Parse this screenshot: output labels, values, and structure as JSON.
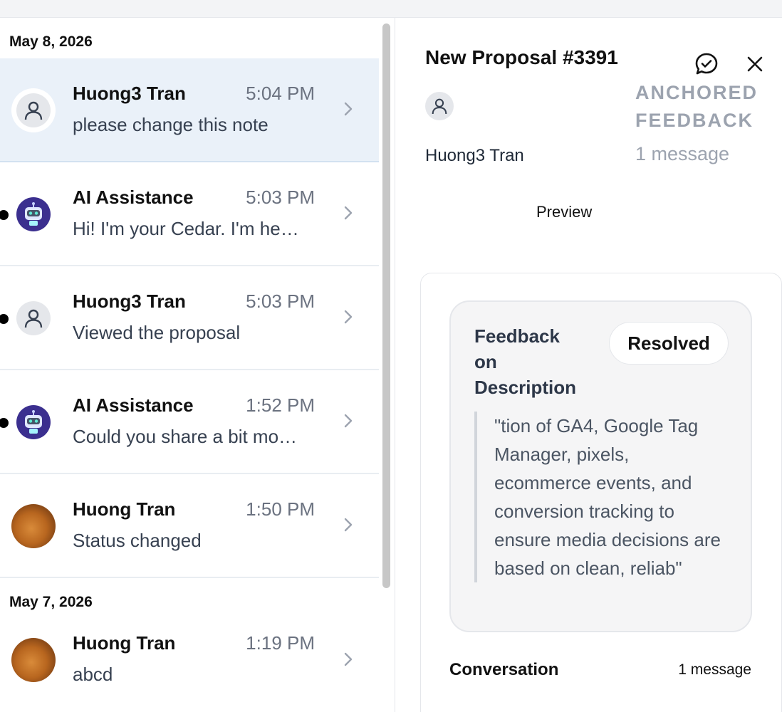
{
  "conversations": {
    "groups": [
      {
        "date": "May 8, 2026",
        "items": [
          {
            "name": "Huong3 Tran",
            "time": "5:04 PM",
            "preview": "please change this note",
            "avatar": "user-icon",
            "unread": false,
            "active": true
          },
          {
            "name": "AI Assistance",
            "time": "5:03 PM",
            "preview": "Hi! I'm your Cedar. I'm he…",
            "avatar": "robot-icon",
            "unread": true,
            "active": false
          },
          {
            "name": "Huong3 Tran",
            "time": "5:03 PM",
            "preview": "Viewed the proposal",
            "avatar": "user-icon",
            "unread": true,
            "active": false
          },
          {
            "name": "AI Assistance",
            "time": "1:52 PM",
            "preview": "Could you share a bit mo…",
            "avatar": "robot-icon",
            "unread": true,
            "active": false
          },
          {
            "name": "Huong Tran",
            "time": "1:50 PM",
            "preview": "Status changed",
            "avatar": "photo",
            "unread": false,
            "active": false
          }
        ]
      },
      {
        "date": "May 7, 2026",
        "items": [
          {
            "name": "Huong Tran",
            "time": "1:19 PM",
            "preview": "abcd",
            "avatar": "photo",
            "unread": false,
            "active": false
          }
        ]
      }
    ]
  },
  "detail": {
    "title": "New Proposal #3391",
    "author": "Huong3 Tran",
    "anchored_label": "ANCHORED FEEDBACK",
    "message_count": "1 message",
    "preview_label": "Preview",
    "feedback": {
      "title": "Feedback on Description",
      "status": "Resolved",
      "quote": "\"tion of GA4, Google Tag Manager, pixels, ecommerce events, and conversion tracking to ensure media decisions are based on clean, reliab\""
    },
    "conversation_label": "Conversation",
    "conversation_count": "1 message"
  },
  "colors": {
    "active_row": "#eaf1f9",
    "ai_avatar": "#3b2f8f",
    "muted_text": "#9ca3af"
  }
}
